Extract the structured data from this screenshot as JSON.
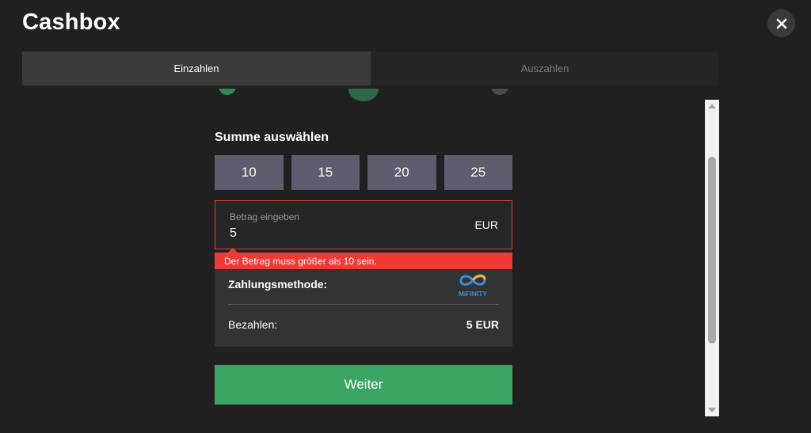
{
  "window": {
    "title": "Cashbox",
    "close_icon": "close-icon"
  },
  "tabs": [
    {
      "label": "Einzahlen",
      "active": true
    },
    {
      "label": "Auszahlen",
      "active": false
    }
  ],
  "deposit": {
    "section_title": "Summe auswählen",
    "amount_options": [
      "10",
      "15",
      "20",
      "25"
    ],
    "input": {
      "label": "Betrag eingeben",
      "value": "5",
      "currency": "EUR"
    },
    "error_message": "Der Betrag muss größer als 10 sein.",
    "summary": {
      "method_label": "Zahlungsmethode:",
      "method_logo_text": "MiFINITY",
      "pay_label": "Bezahlen:",
      "pay_value": "5 EUR"
    },
    "continue_label": "Weiter"
  },
  "colors": {
    "background": "#202020",
    "tab_active": "#3a3a3a",
    "amount_button": "#5e5c6e",
    "error": "#f03a35",
    "primary_button": "#3ba564"
  }
}
